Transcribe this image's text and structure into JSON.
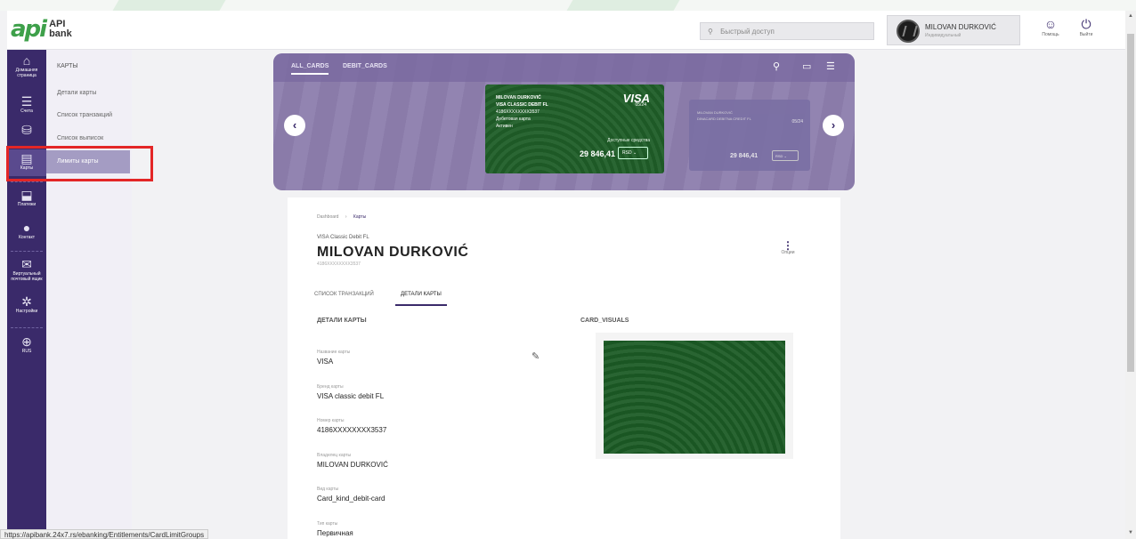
{
  "header": {
    "logo_mark": "api",
    "logo_text_1": "API",
    "logo_text_2": "bank",
    "search_placeholder": "Быстрый доступ",
    "user_name": "MILOVAN DURKOVIĆ",
    "user_role": "Индивидуальный",
    "help_label": "Помощь",
    "logout_label": "Выйти"
  },
  "sidebar": {
    "items": [
      {
        "label": "Домашняя страница",
        "icon": "home-icon"
      },
      {
        "label": "Счета",
        "icon": "list-icon"
      },
      {
        "label": "",
        "icon": "coins-icon"
      },
      {
        "label": "Карты",
        "icon": "card-icon"
      },
      {
        "label": "Платежи",
        "icon": "payment-icon"
      },
      {
        "label": "Контакт",
        "icon": "chat-icon"
      },
      {
        "label": "Виртуальный почтовый ящик",
        "icon": "mail-icon"
      },
      {
        "label": "Настройки",
        "icon": "gear-icon"
      },
      {
        "label": "RUS",
        "icon": "globe-icon"
      }
    ]
  },
  "submenu": {
    "head": "КАРТЫ",
    "items": [
      "Детали карты",
      "Список транзакций",
      "Список выписок",
      "Лимиты карты"
    ]
  },
  "banner": {
    "tabs": [
      "ALL_CARDS",
      "DEBIT_CARDS"
    ],
    "card_main": {
      "holder": "MILOVAN DURKOVIĆ",
      "product": "VISA CLASSIC DEBIT FL",
      "pan": "4186XXXXXXXX3537",
      "type": "Дебетовая карта",
      "status": "Активен",
      "brand": "VISA",
      "expiry": "05/24",
      "available_label": "Доступные средства",
      "balance": "29 846,41",
      "currency": "RSD ⌄"
    },
    "card_ghost": {
      "holder": "MILOVAN DURKOVIĆ",
      "product": "DINACARD DEBITNA CREDIT FL",
      "expiry": "05/24",
      "balance": "29 846,41",
      "currency": "RSD ⌄"
    }
  },
  "panel": {
    "crumb_1": "Dashboard",
    "crumb_sep": "›",
    "crumb_2": "Карты",
    "subtitle": "VISA Classic Debit FL",
    "title": "MILOVAN DURKOVIĆ",
    "pan": "4186XXXXXXXX3537",
    "options_label": "Опции",
    "tabs": [
      "СПИСОК ТРАНЗАКЦИЙ",
      "ДЕТАЛИ КАРТЫ"
    ],
    "details_title": "ДЕТАЛИ КАРТЫ",
    "visuals_title": "CARD_VISUALS",
    "fields": [
      {
        "label": "Название карты",
        "value": "VISA"
      },
      {
        "label": "Бренд карты",
        "value": "VISA classic debit FL"
      },
      {
        "label": "Номер карты",
        "value": "4186XXXXXXXX3537"
      },
      {
        "label": "Владелец карты",
        "value": "MILOVAN DURKOVIĆ"
      },
      {
        "label": "Вид карты",
        "value": "Card_kind_debit-card"
      },
      {
        "label": "Тип карты",
        "value": "Первичная"
      }
    ]
  },
  "status_url": "https://apibank.24x7.rs/ebanking/Entitlements/CardLimitGroups"
}
